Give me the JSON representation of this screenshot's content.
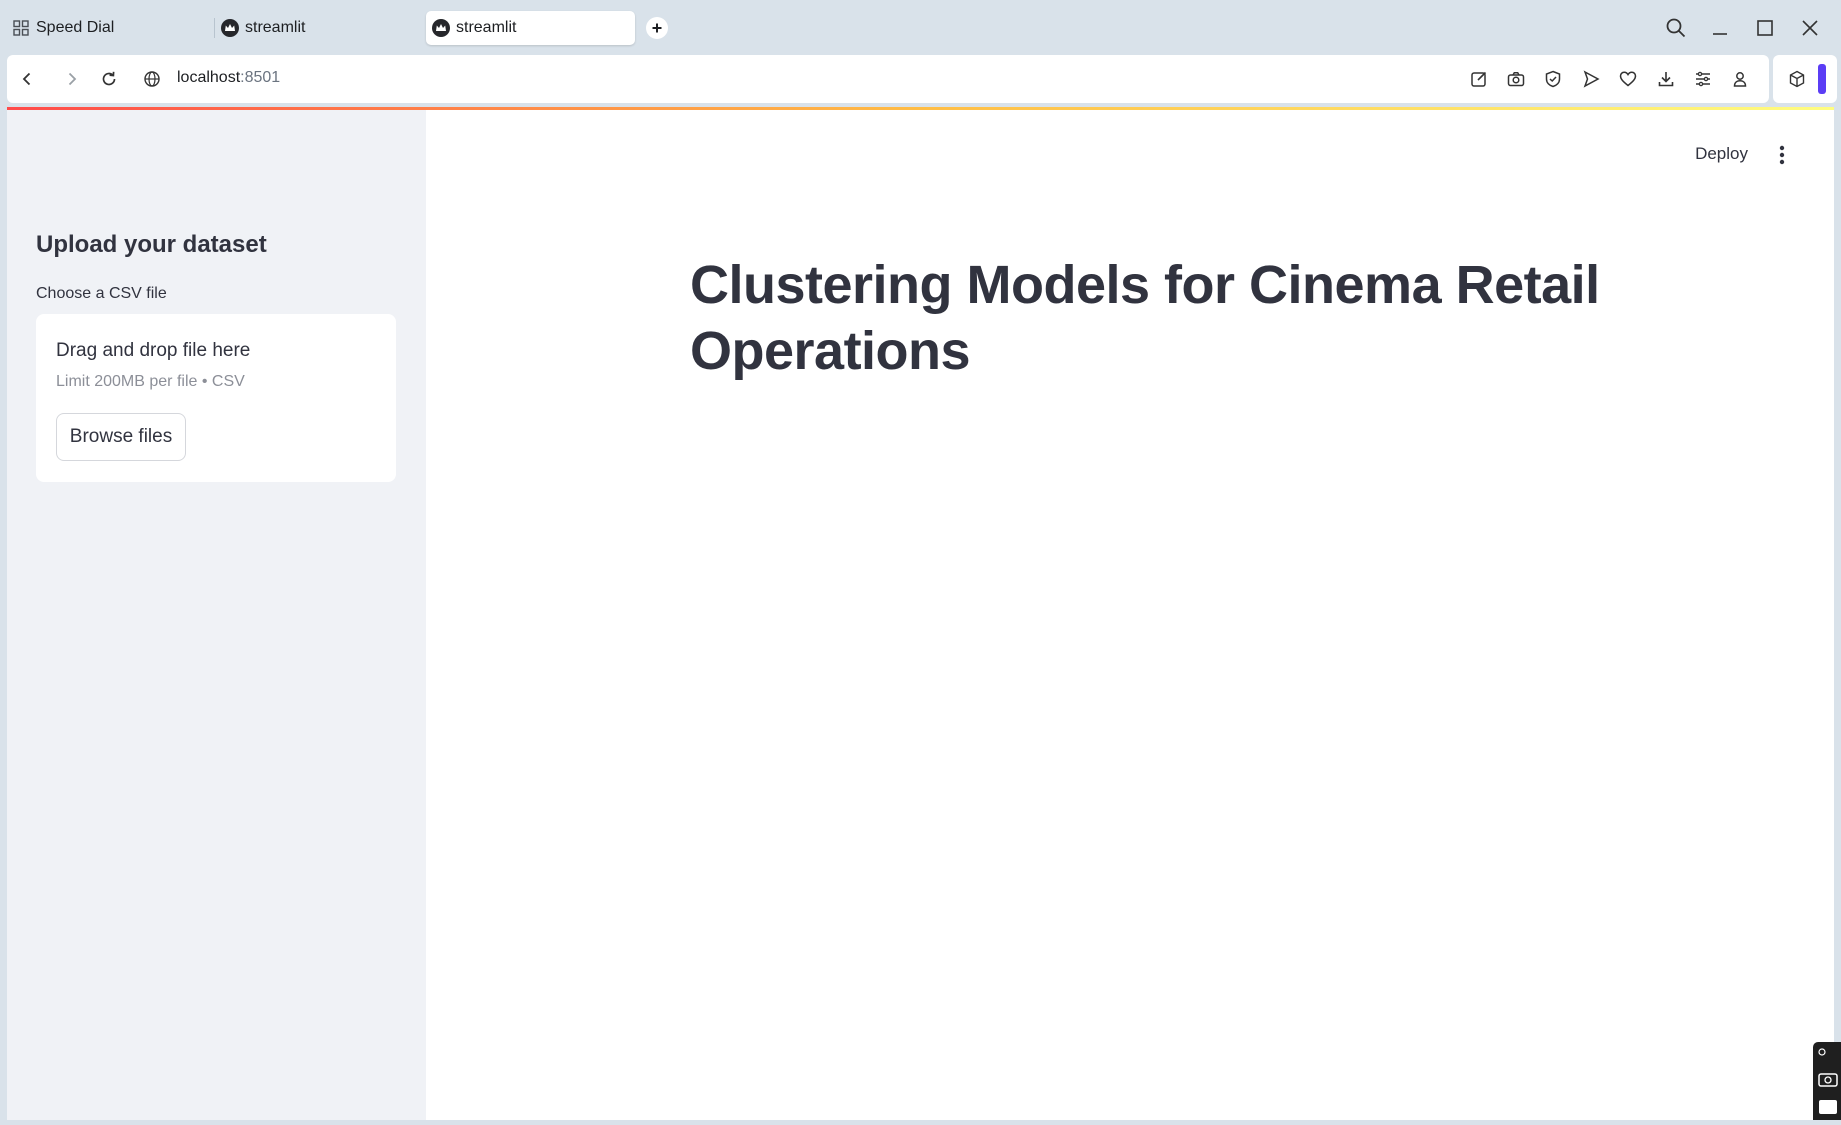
{
  "browser": {
    "tabs": [
      {
        "title": "Speed Dial",
        "icon": "grid-icon",
        "active": false
      },
      {
        "title": "streamlit",
        "icon": "streamlit-crown-icon",
        "active": false
      },
      {
        "title": "streamlit",
        "icon": "streamlit-crown-icon",
        "active": true
      }
    ],
    "address": {
      "host": "localhost",
      "port": ":8501"
    },
    "toolbar_icons": [
      "edit-icon",
      "camera-icon",
      "shield-icon",
      "send-icon",
      "heart-icon",
      "download-icon",
      "sliders-icon",
      "profile-icon",
      "cube-icon"
    ]
  },
  "sidebar": {
    "header": "Upload your dataset",
    "uploader_label": "Choose a CSV file",
    "dropzone_title": "Drag and drop file here",
    "dropzone_limit": "Limit 200MB per file • CSV",
    "browse_button": "Browse files"
  },
  "main": {
    "deploy_label": "Deploy",
    "title": "Clustering Models for Cinema Retail Operations"
  },
  "colors": {
    "accent_gradient": [
      "#ff4b4b",
      "#ffbd45",
      "#fffd80"
    ],
    "sidebar_bg": "#f0f2f6",
    "text": "#31333f",
    "extension_accent": "#5b3df5"
  }
}
